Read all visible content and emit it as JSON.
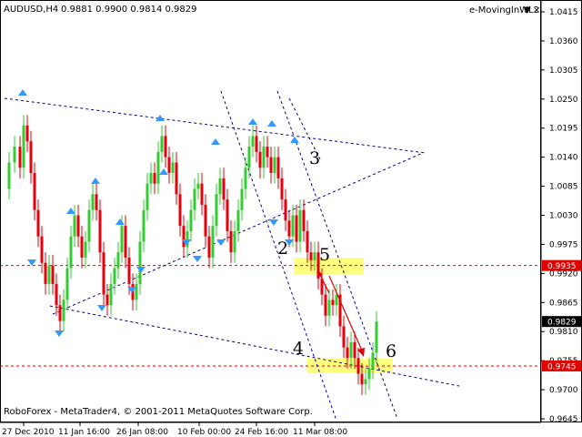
{
  "header": {
    "symbol": "AUDUSD,H4",
    "ohlc": "0.9881 0.9900 0.9814 0.9829",
    "indicator": "e-MovingInWL2",
    "win_buttons": [
      "▼",
      "×"
    ]
  },
  "footer": {
    "copyright": "RoboForex - MetaTrader4, © 2001-2011 MetaQuotes Software Corp."
  },
  "colors": {
    "bull": "#33cc33",
    "bear": "#e8000e",
    "arrow": "#3399ff",
    "trend": "#00008b",
    "level": "#e00000",
    "highlight": "#ffff80",
    "price_tag": "#000000",
    "level_tag": "#e00000"
  },
  "chart_data": {
    "type": "candlestick",
    "symbol": "AUDUSD",
    "timeframe": "H4",
    "ylim": [
      0.9645,
      1.0415
    ],
    "y_ticks": [
      "1.0415",
      "1.0360",
      "1.0305",
      "1.0250",
      "1.0195",
      "1.0140",
      "1.0085",
      "1.0030",
      "0.9975",
      "0.9920",
      "0.9865",
      "0.9810",
      "0.9755",
      "0.9700",
      "0.9645"
    ],
    "x_ticks": [
      "27 Dec 2010",
      "11 Jan 16:00",
      "26 Jan 08:00",
      "10 Feb 00:00",
      "24 Feb 16:00",
      "11 Mar 08:00"
    ],
    "current_price": "0.9829",
    "levels": [
      {
        "value": 0.9935,
        "label": "0.9935"
      },
      {
        "value": 0.9745,
        "label": "0.9745"
      }
    ],
    "wave_labels": [
      "2",
      "3",
      "4",
      "5",
      "6"
    ],
    "price_path": [
      [
        0,
        1.008
      ],
      [
        6,
        1.013
      ],
      [
        12,
        1.016
      ],
      [
        18,
        1.012
      ],
      [
        22,
        1.02
      ],
      [
        26,
        1.017
      ],
      [
        30,
        1.011
      ],
      [
        34,
        1.004
      ],
      [
        38,
        0.999
      ],
      [
        42,
        0.994
      ],
      [
        46,
        0.99
      ],
      [
        50,
        0.9935
      ],
      [
        54,
        0.99
      ],
      [
        58,
        0.986
      ],
      [
        62,
        0.983
      ],
      [
        66,
        0.987
      ],
      [
        70,
        0.993
      ],
      [
        74,
        0.999
      ],
      [
        78,
        1.003
      ],
      [
        82,
        0.999
      ],
      [
        86,
        0.995
      ],
      [
        90,
        0.998
      ],
      [
        94,
        1.004
      ],
      [
        98,
        1.007
      ],
      [
        102,
        1.004
      ],
      [
        106,
        0.996
      ],
      [
        110,
        0.988
      ],
      [
        114,
        0.986
      ],
      [
        118,
        0.99
      ],
      [
        122,
        0.993
      ],
      [
        126,
        0.996
      ],
      [
        130,
        1.001
      ],
      [
        134,
        0.995
      ],
      [
        138,
        0.99
      ],
      [
        142,
        0.987
      ],
      [
        146,
        0.99
      ],
      [
        150,
        0.998
      ],
      [
        154,
        1.004
      ],
      [
        158,
        1.009
      ],
      [
        162,
        1.011
      ],
      [
        166,
        1.009
      ],
      [
        170,
        1.015
      ],
      [
        174,
        1.018
      ],
      [
        178,
        1.014
      ],
      [
        182,
        1.011
      ],
      [
        186,
        1.013
      ],
      [
        190,
        1.007
      ],
      [
        194,
        1.001
      ],
      [
        198,
        0.997
      ],
      [
        202,
        1.0
      ],
      [
        206,
        1.004
      ],
      [
        210,
        1.008
      ],
      [
        214,
        1.009
      ],
      [
        218,
        1.005
      ],
      [
        222,
        0.999
      ],
      [
        226,
        0.995
      ],
      [
        230,
        1.001
      ],
      [
        234,
        1.007
      ],
      [
        238,
        1.01
      ],
      [
        242,
        1.006
      ],
      [
        246,
        1.0
      ],
      [
        250,
        0.996
      ],
      [
        254,
        1.0
      ],
      [
        258,
        1.004
      ],
      [
        262,
        1.008
      ],
      [
        266,
        1.012
      ],
      [
        270,
        1.016
      ],
      [
        274,
        1.018
      ],
      [
        278,
        1.015
      ],
      [
        282,
        1.012
      ],
      [
        286,
        1.016
      ],
      [
        290,
        1.014
      ],
      [
        294,
        1.011
      ],
      [
        298,
        1.014
      ],
      [
        302,
        1.01
      ],
      [
        306,
        1.006
      ],
      [
        310,
        1.002
      ],
      [
        314,
        0.999
      ],
      [
        318,
        1.003
      ],
      [
        322,
        0.998
      ],
      [
        326,
        1.004
      ],
      [
        330,
        1.0
      ],
      [
        334,
        0.996
      ],
      [
        338,
        0.9945
      ],
      [
        342,
        0.996
      ],
      [
        346,
        0.991
      ],
      [
        350,
        0.988
      ],
      [
        354,
        0.984
      ],
      [
        358,
        0.987
      ],
      [
        362,
        0.986
      ],
      [
        366,
        0.988
      ],
      [
        370,
        0.982
      ],
      [
        374,
        0.978
      ],
      [
        378,
        0.976
      ],
      [
        382,
        0.979
      ],
      [
        386,
        0.976
      ],
      [
        390,
        0.973
      ],
      [
        394,
        0.971
      ],
      [
        398,
        0.972
      ],
      [
        402,
        0.974
      ],
      [
        406,
        0.977
      ],
      [
        410,
        0.9829
      ]
    ]
  }
}
